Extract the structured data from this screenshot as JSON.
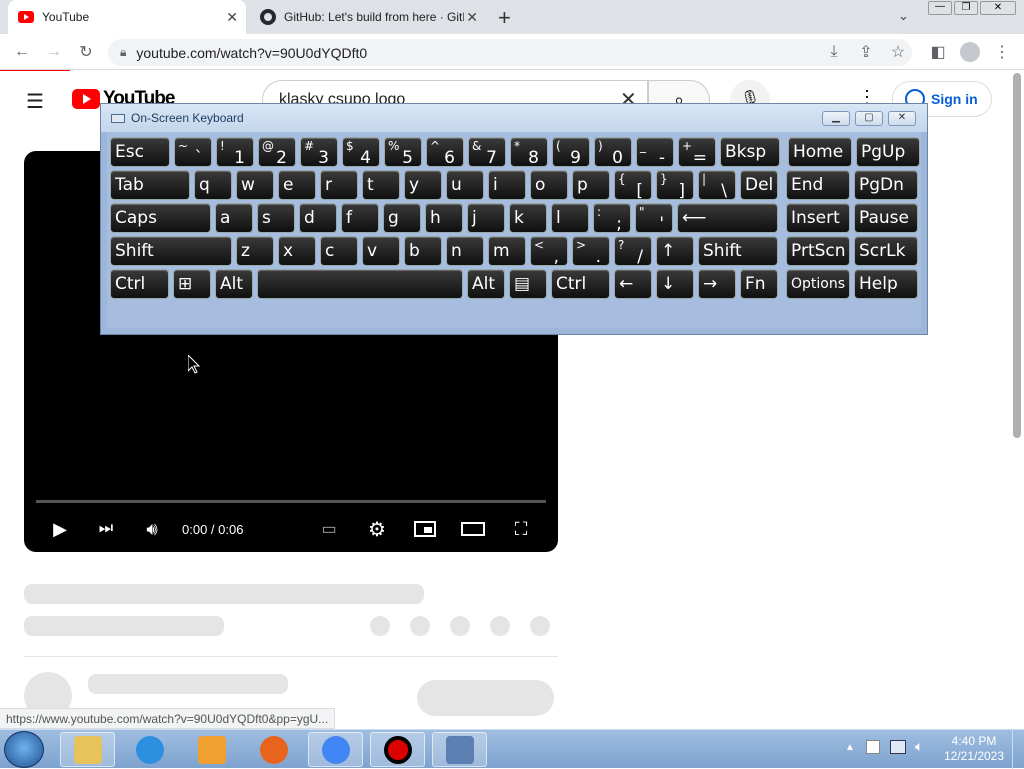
{
  "browser": {
    "tabs": [
      {
        "title": "YouTube",
        "favicon": "youtube-icon",
        "active": true
      },
      {
        "title": "GitHub: Let's build from here · GitHub",
        "favicon": "github-icon",
        "active": false
      }
    ],
    "new_tab_label": "+",
    "url": "youtube.com/watch?v=90U0dYQDft0",
    "status_url": "https://www.youtube.com/watch?v=90U0dYQDft0&pp=ygU..."
  },
  "youtube": {
    "logo_text": "YouTube",
    "search_value": "klasky csupo logo",
    "signin_label": "Sign in",
    "player": {
      "time": "0:00 / 0:06"
    }
  },
  "osk": {
    "title": "On-Screen Keyboard",
    "rows": [
      [
        {
          "label": "Esc"
        },
        {
          "label": "`",
          "sup": "~"
        },
        {
          "label": "1",
          "sup": "!"
        },
        {
          "label": "2",
          "sup": "@"
        },
        {
          "label": "3",
          "sup": "#"
        },
        {
          "label": "4",
          "sup": "$"
        },
        {
          "label": "5",
          "sup": "%"
        },
        {
          "label": "6",
          "sup": "^"
        },
        {
          "label": "7",
          "sup": "&"
        },
        {
          "label": "8",
          "sup": "*"
        },
        {
          "label": "9",
          "sup": "("
        },
        {
          "label": "0",
          "sup": ")"
        },
        {
          "label": "-",
          "sup": "_"
        },
        {
          "label": "=",
          "sup": "+"
        },
        {
          "label": "Bksp"
        },
        {
          "label": "Home"
        },
        {
          "label": "PgUp"
        }
      ],
      [
        {
          "label": "Tab"
        },
        {
          "label": "q"
        },
        {
          "label": "w"
        },
        {
          "label": "e"
        },
        {
          "label": "r"
        },
        {
          "label": "t"
        },
        {
          "label": "y"
        },
        {
          "label": "u"
        },
        {
          "label": "i"
        },
        {
          "label": "o"
        },
        {
          "label": "p"
        },
        {
          "label": "[",
          "sup": "{"
        },
        {
          "label": "]",
          "sup": "}"
        },
        {
          "label": "\\",
          "sup": "|"
        },
        {
          "label": "Del"
        },
        {
          "label": "End"
        },
        {
          "label": "PgDn"
        }
      ],
      [
        {
          "label": "Caps"
        },
        {
          "label": "a"
        },
        {
          "label": "s"
        },
        {
          "label": "d"
        },
        {
          "label": "f"
        },
        {
          "label": "g"
        },
        {
          "label": "h"
        },
        {
          "label": "j"
        },
        {
          "label": "k"
        },
        {
          "label": "l"
        },
        {
          "label": ";",
          "sup": ":"
        },
        {
          "label": "'",
          "sup": "\""
        },
        {
          "label": "⟵"
        },
        {
          "label": "Insert"
        },
        {
          "label": "Pause"
        }
      ],
      [
        {
          "label": "Shift"
        },
        {
          "label": "z"
        },
        {
          "label": "x"
        },
        {
          "label": "c"
        },
        {
          "label": "v"
        },
        {
          "label": "b"
        },
        {
          "label": "n"
        },
        {
          "label": "m"
        },
        {
          "label": ",",
          "sup": "<"
        },
        {
          "label": ".",
          "sup": ">"
        },
        {
          "label": "/",
          "sup": "?"
        },
        {
          "label": "↑"
        },
        {
          "label": "Shift"
        },
        {
          "label": "PrtScn"
        },
        {
          "label": "ScrLk"
        }
      ],
      [
        {
          "label": "Ctrl"
        },
        {
          "label": "⊞"
        },
        {
          "label": "Alt"
        },
        {
          "label": ""
        },
        {
          "label": "Alt"
        },
        {
          "label": "▤"
        },
        {
          "label": "Ctrl"
        },
        {
          "label": "←"
        },
        {
          "label": "↓"
        },
        {
          "label": "→"
        },
        {
          "label": "Fn"
        },
        {
          "label": "Options"
        },
        {
          "label": "Help"
        }
      ]
    ]
  },
  "taskbar": {
    "apps": [
      "file-explorer-icon",
      "internet-explorer-icon",
      "media-player-icon",
      "firefox-icon",
      "chrome-icon",
      "record-icon",
      "on-screen-keyboard-icon"
    ],
    "time": "4:40 PM",
    "date": "12/21/2023"
  }
}
